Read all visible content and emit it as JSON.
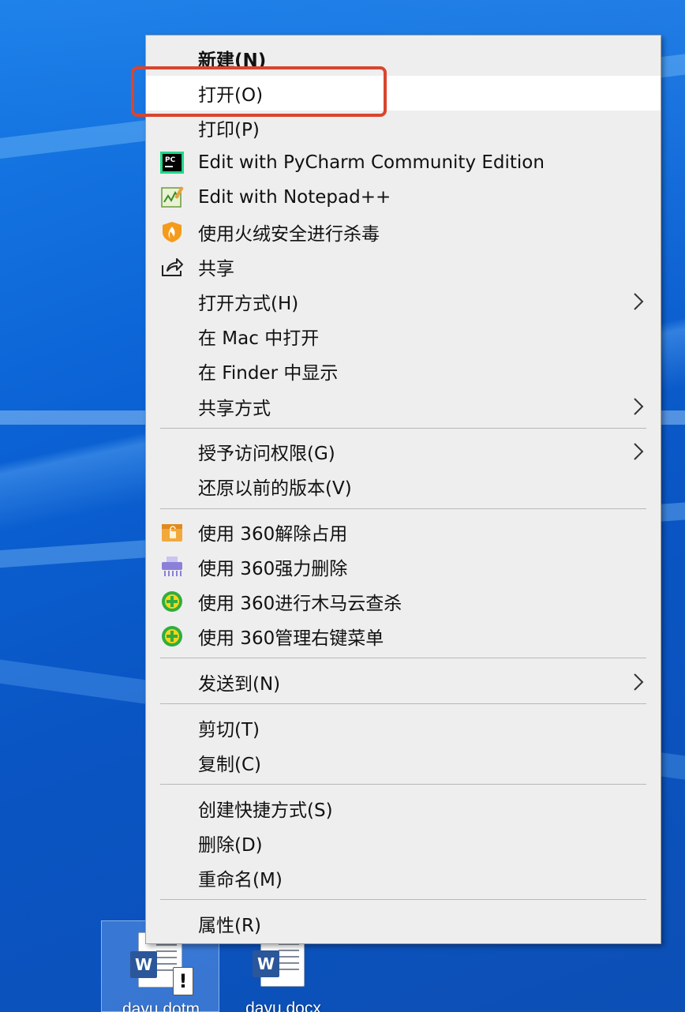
{
  "desktop": {
    "icons": [
      {
        "label": "dayu.dotm",
        "badge": "W",
        "warn": "!"
      },
      {
        "label": "dayu.docx",
        "badge": "W"
      }
    ]
  },
  "menu": {
    "items": [
      {
        "label": "新建(N)",
        "bold": true
      },
      {
        "label": "打开(O)",
        "highlighted": true
      },
      {
        "label": "打印(P)"
      },
      {
        "label": "Edit with PyCharm Community Edition",
        "icon": "pycharm-icon",
        "icon_text": "PC"
      },
      {
        "label": "Edit with Notepad++",
        "icon": "notepad-plus-plus-icon"
      },
      {
        "label": "使用火绒安全进行杀毒",
        "icon": "huorong-shield-icon"
      },
      {
        "label": "共享",
        "icon": "share-icon"
      },
      {
        "label": "打开方式(H)",
        "submenu": true
      },
      {
        "label": "在 Mac 中打开"
      },
      {
        "label": "在 Finder 中显示"
      },
      {
        "label": "共享方式",
        "submenu": true
      },
      {
        "label": "授予访问权限(G)",
        "submenu": true
      },
      {
        "label": "还原以前的版本(V)"
      },
      {
        "label": "使用 360解除占用",
        "icon": "360-unlock-icon"
      },
      {
        "label": "使用 360强力删除",
        "icon": "360-shredder-icon"
      },
      {
        "label": "使用 360进行木马云查杀",
        "icon": "360-scan-icon"
      },
      {
        "label": "使用 360管理右键菜单",
        "icon": "360-menu-manager-icon"
      },
      {
        "label": "发送到(N)",
        "submenu": true
      },
      {
        "label": "剪切(T)"
      },
      {
        "label": "复制(C)"
      },
      {
        "label": "创建快捷方式(S)"
      },
      {
        "label": "删除(D)"
      },
      {
        "label": "重命名(M)"
      },
      {
        "label": "属性(R)"
      }
    ]
  },
  "colors": {
    "menu_background": "#eeeeee",
    "hover_background": "#ffffff",
    "highlight_box": "#d9452f",
    "desktop_blue": "#0a5fd0"
  }
}
